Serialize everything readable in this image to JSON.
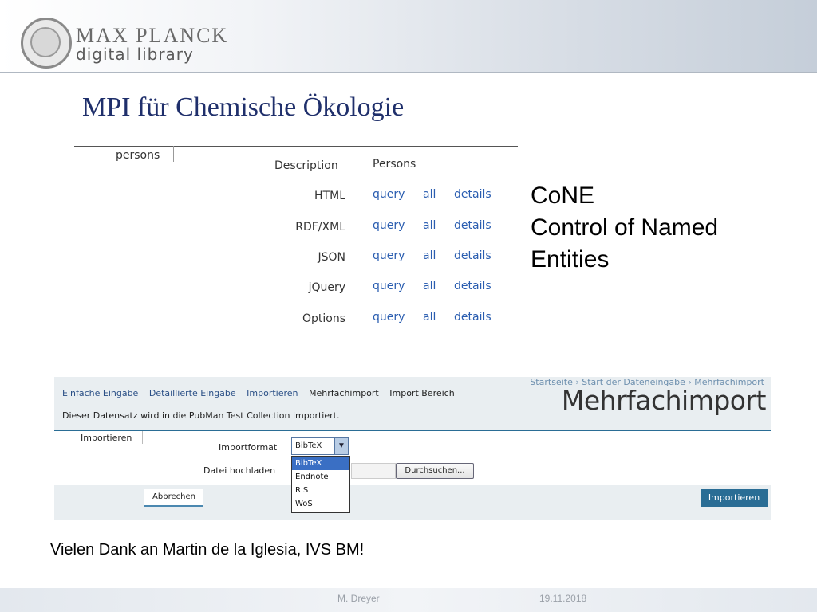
{
  "header": {
    "logo_top": "MAX PLANCK",
    "logo_bottom": "digital library"
  },
  "title": "MPI für Chemische Ökologie",
  "cone_table": {
    "tab_label": "persons",
    "description_label": "Description",
    "description_value": "Persons",
    "rows": [
      {
        "format": "HTML",
        "query": "query",
        "all": "all",
        "details": "details"
      },
      {
        "format": "RDF/XML",
        "query": "query",
        "all": "all",
        "details": "details"
      },
      {
        "format": "JSON",
        "query": "query",
        "all": "all",
        "details": "details"
      },
      {
        "format": "jQuery",
        "query": "query",
        "all": "all",
        "details": "details"
      },
      {
        "format": "Options",
        "query": "query",
        "all": "all",
        "details": "details"
      }
    ]
  },
  "cone_caption": {
    "line1": "CoNE",
    "line2": "Control of Named",
    "line3": "Entities"
  },
  "import_screen": {
    "nav": [
      "Einfache Eingabe",
      "Detaillierte Eingabe",
      "Importieren",
      "Mehrfachimport",
      "Import Bereich"
    ],
    "breadcrumb": "Startseite › Start der Dateneingabe › Mehrfachimport",
    "heading": "Mehrfachimport",
    "info": "Dieser Datensatz wird in die PubMan Test Collection importiert.",
    "tab": "Importieren",
    "format_label": "Importformat",
    "format_selected": "BibTeX",
    "format_options": [
      "BibTeX",
      "Endnote",
      "RIS",
      "WoS"
    ],
    "upload_label": "Datei hochladen",
    "browse_label": "Durchsuchen...",
    "cancel_label": "Abbrechen",
    "submit_label": "Importieren"
  },
  "thanks": "Vielen Dank an Martin de la Iglesia, IVS BM!",
  "footer": {
    "author": "M. Dreyer",
    "date": "19.11.2018"
  }
}
